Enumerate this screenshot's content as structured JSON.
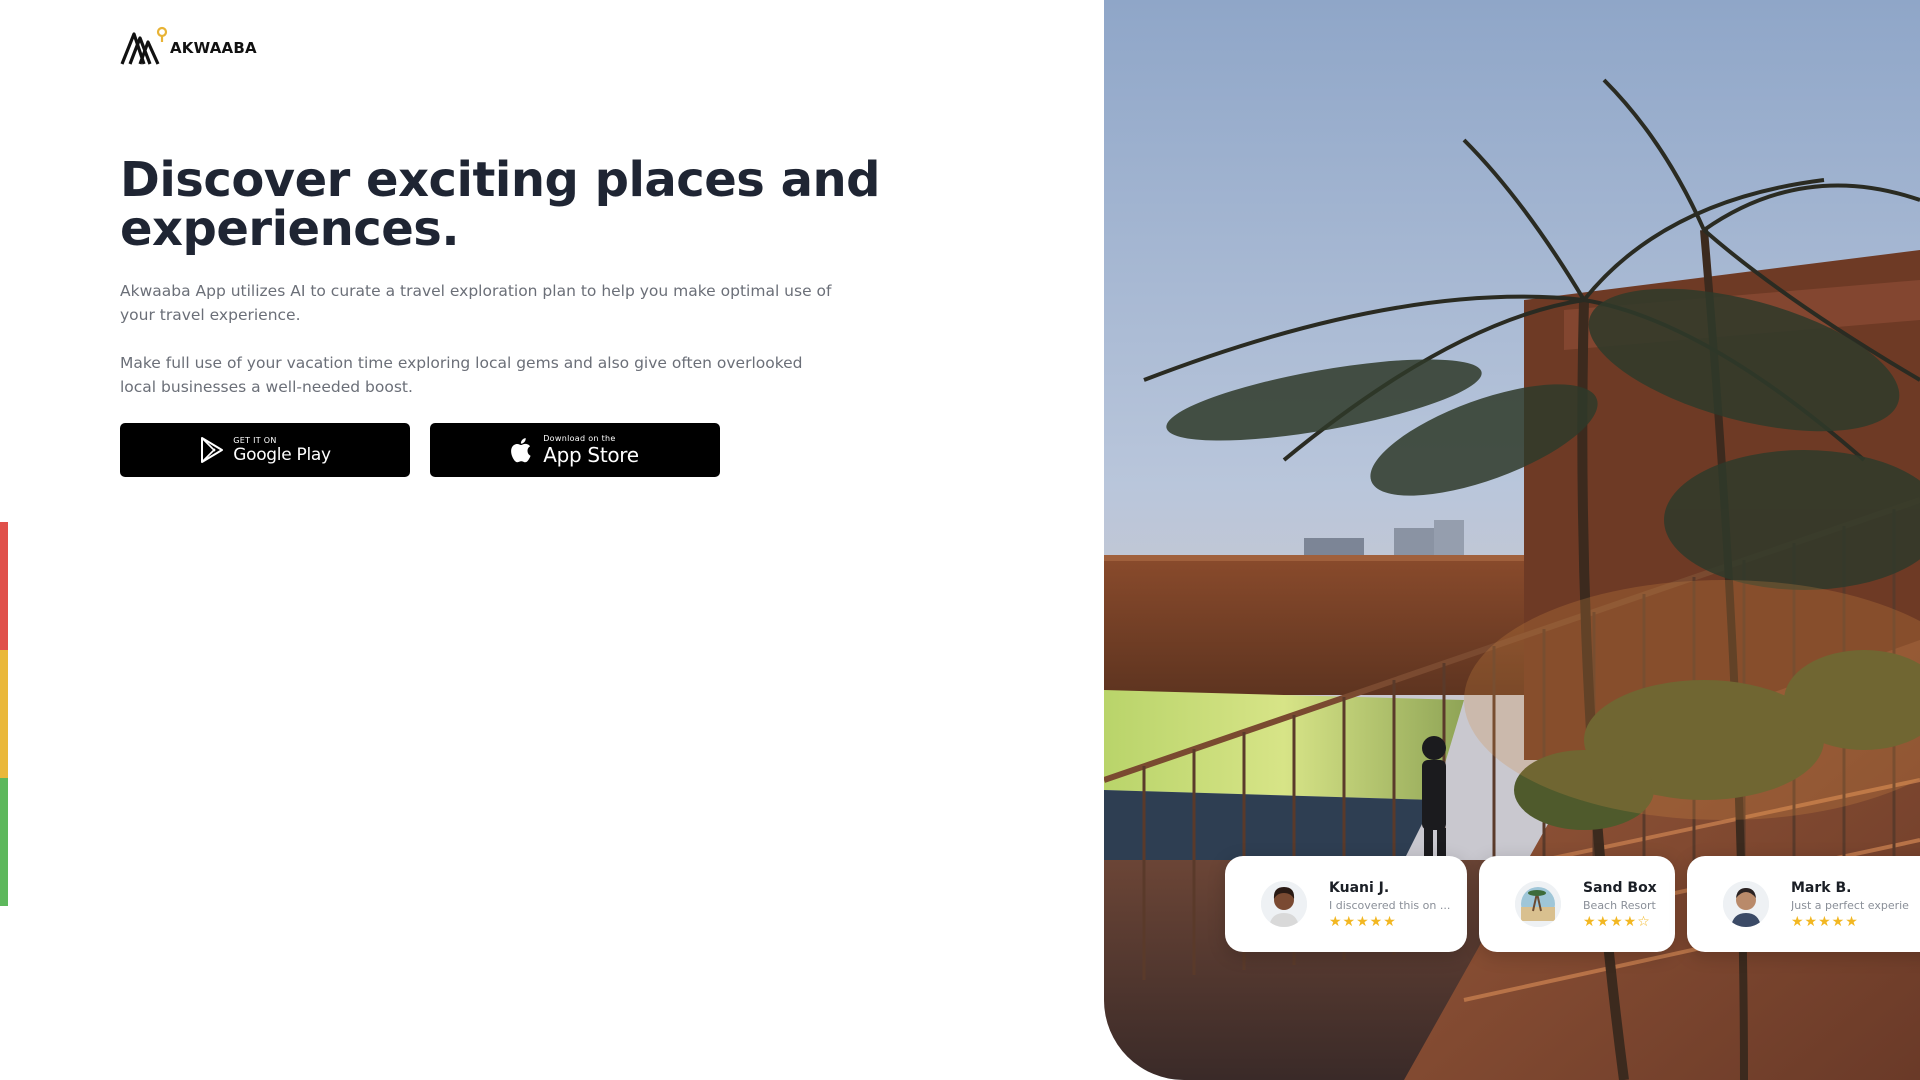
{
  "brand": {
    "name": "AKWAABA",
    "colors": {
      "red": "#e0504a",
      "yellow": "#eab83a",
      "green": "#5db85c",
      "pin": "#e8b335"
    }
  },
  "hero": {
    "title": "Discover exciting places and experiences.",
    "paragraph1": "Akwaaba App utilizes AI to curate a travel exploration plan to help you make optimal use of your travel experience.",
    "paragraph2": "Make full use of your vacation time exploring local gems and also give often overlooked local businesses a well-needed boost."
  },
  "store_buttons": {
    "google": {
      "small": "GET IT ON",
      "big": "Google Play",
      "icon": "google-play-icon"
    },
    "apple": {
      "small": "Download on the",
      "big": "App Store",
      "icon": "apple-icon"
    }
  },
  "reviews": [
    {
      "name": "Kuani J.",
      "text": "I discovered this on ...",
      "rating": 5,
      "stars": "★★★★★",
      "avatar": "woman-avatar"
    },
    {
      "name": "Sand Box",
      "text": "Beach Resort",
      "rating": 4,
      "stars": "★★★★☆",
      "avatar": "beach-avatar"
    },
    {
      "name": "Mark B.",
      "text": "Just a perfect experie",
      "rating": 5,
      "stars": "★★★★★",
      "avatar": "man-avatar"
    }
  ]
}
